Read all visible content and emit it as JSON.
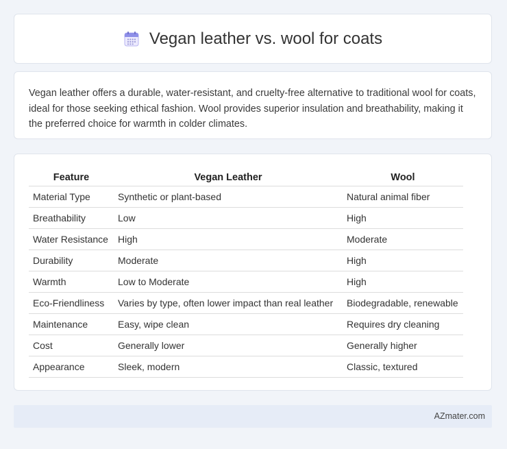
{
  "header": {
    "title": "Vegan leather vs. wool for coats",
    "icon": "calendar-icon"
  },
  "summary": {
    "text": "Vegan leather offers a durable, water-resistant, and cruelty-free alternative to traditional wool for coats, ideal for those seeking ethical fashion. Wool provides superior insulation and breathability, making it the preferred choice for warmth in colder climates."
  },
  "table": {
    "headers": [
      "Feature",
      "Vegan Leather",
      "Wool"
    ],
    "rows": [
      [
        "Material Type",
        "Synthetic or plant-based",
        "Natural animal fiber"
      ],
      [
        "Breathability",
        "Low",
        "High"
      ],
      [
        "Water Resistance",
        "High",
        "Moderate"
      ],
      [
        "Durability",
        "Moderate",
        "High"
      ],
      [
        "Warmth",
        "Low to Moderate",
        "High"
      ],
      [
        "Eco-Friendliness",
        "Varies by type, often lower impact than real leather",
        "Biodegradable, renewable"
      ],
      [
        "Maintenance",
        "Easy, wipe clean",
        "Requires dry cleaning"
      ],
      [
        "Cost",
        "Generally lower",
        "Generally higher"
      ],
      [
        "Appearance",
        "Sleek, modern",
        "Classic, textured"
      ]
    ]
  },
  "footer": {
    "site": "AZmater.com"
  },
  "colors": {
    "background": "#f1f4f9",
    "card": "#ffffff",
    "footer": "#e6ecf7",
    "icon_accent": "#8e8fe8"
  }
}
